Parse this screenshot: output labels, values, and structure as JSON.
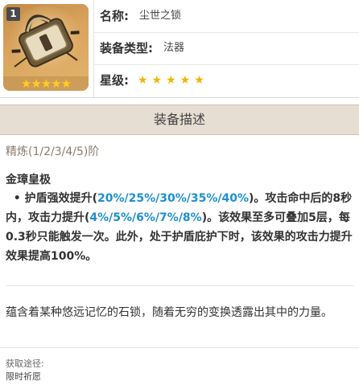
{
  "weapon": {
    "refinement_badge": "1",
    "rarity_stars": "★★★★★",
    "icon": "memory-of-dust-catalyst-icon"
  },
  "info": {
    "name_label": "名称:",
    "name_value": "尘世之锁",
    "type_label": "装备类型:",
    "type_value": "法器",
    "rarity_label": "星级:",
    "rarity_value": "★★★★★"
  },
  "description": {
    "header": "装备描述",
    "refinement": "精炼(1/2/3/4/5)阶",
    "passive_name": "金璋皇极",
    "passive_bullet": "•",
    "passive_text_1": "护盾强效提升(",
    "passive_values_1": "20%/25%/30%/35%/40%",
    "passive_text_2": ")。攻击命中后的8秒内，攻击力提升(",
    "passive_values_2": "4%/5%/6%/7%/8%",
    "passive_text_3": ")。该效果至多可叠加5层，每0.3秒只能触发一次。此外，处于护盾庇护下时，该效果的攻击力提升效果提高100%。",
    "flavor": "蕴含着某种悠远记忆的石锁，随着无穷的变换透露出其中的力量。"
  },
  "source": {
    "label": "获取途径:",
    "value": "限时祈愿"
  },
  "colors": {
    "highlight": "#1d8fd1",
    "header_bg": "#e6ddd3",
    "star": "#f2b300"
  }
}
